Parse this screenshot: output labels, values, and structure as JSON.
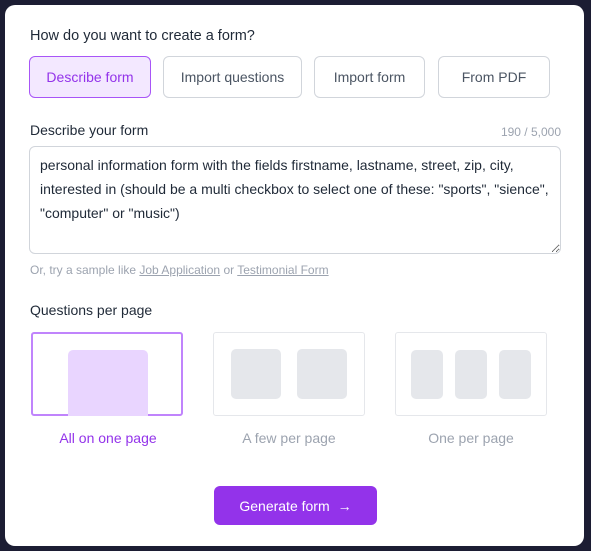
{
  "title": "How do you want to create a form?",
  "methods": [
    {
      "label": "Describe form",
      "selected": true
    },
    {
      "label": "Import questions"
    },
    {
      "label": "Import form"
    },
    {
      "label": "From PDF"
    }
  ],
  "describe": {
    "label": "Describe your form",
    "counter": "190 / 5,000",
    "value": "personal information form with the fields firstname, lastname, street, zip, city, interested in (should be a multi checkbox to select one of these: \"sports\", \"sience\", \"computer\" or \"music\")"
  },
  "hint": {
    "prefix": "Or, try a sample like ",
    "link1": "Job Application",
    "mid": " or ",
    "link2": "Testimonial Form"
  },
  "qpp": {
    "label": "Questions per page",
    "options": [
      {
        "label": "All on one page",
        "selected": true
      },
      {
        "label": "A few per page"
      },
      {
        "label": "One per page"
      }
    ]
  },
  "generate": {
    "label": "Generate form",
    "icon": "arrow-right-icon"
  },
  "colors": {
    "accent": "#9333ea",
    "accent_light": "#f3e8ff"
  }
}
